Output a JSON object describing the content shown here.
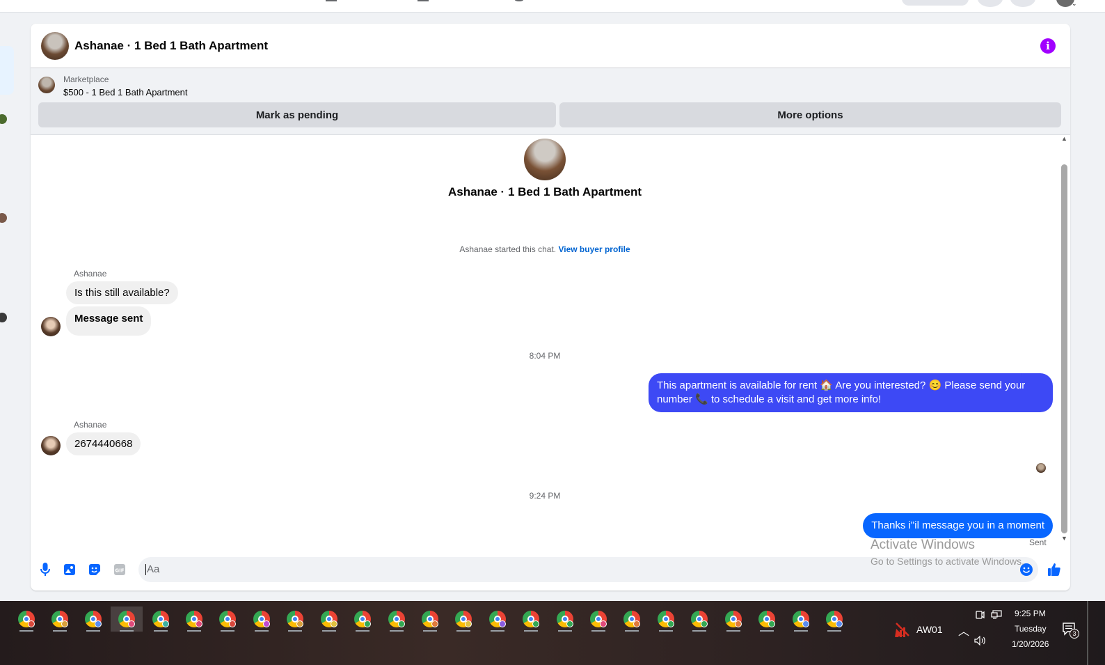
{
  "header": {
    "title": "Ashanae · 1 Bed 1 Bath Apartment"
  },
  "marketplace": {
    "label": "Marketplace",
    "listing": "$500 - 1 Bed 1 Bath Apartment",
    "mark_pending_label": "Mark as pending",
    "more_options_label": "More options"
  },
  "chat": {
    "title": "Ashanae · 1 Bed 1 Bath Apartment",
    "started_text": "Ashanae started this chat.",
    "view_profile_label": "View buyer profile",
    "messages": [
      {
        "sender": "Ashanae",
        "text": "Is this still available?"
      },
      {
        "text": "Message sent"
      },
      {
        "time": "8:04 PM"
      },
      {
        "text": "This apartment is available for rent 🏠 Are you interested? 😊 Please send your number 📞 to schedule a visit and get more info!"
      },
      {
        "sender": "Ashanae",
        "text": "2674440668"
      },
      {
        "time": "9:24 PM"
      },
      {
        "text": "Thanks i\"il message you in a moment"
      }
    ],
    "sent_status": "Sent"
  },
  "composer": {
    "placeholder": "Aa"
  },
  "watermark": {
    "line1": "Activate Windows",
    "line2": "Go to Settings to activate Windows."
  },
  "taskbar": {
    "tray_app": "AW01",
    "time": "9:25 PM",
    "day": "Tuesday",
    "date": "1/20/2026",
    "notification_count": "3"
  },
  "colors": {
    "outgoing_bubble_1": "#3d49f5",
    "outgoing_bubble_2": "#0866ff",
    "info_icon": "#a100ff",
    "link": "#0064d1"
  }
}
